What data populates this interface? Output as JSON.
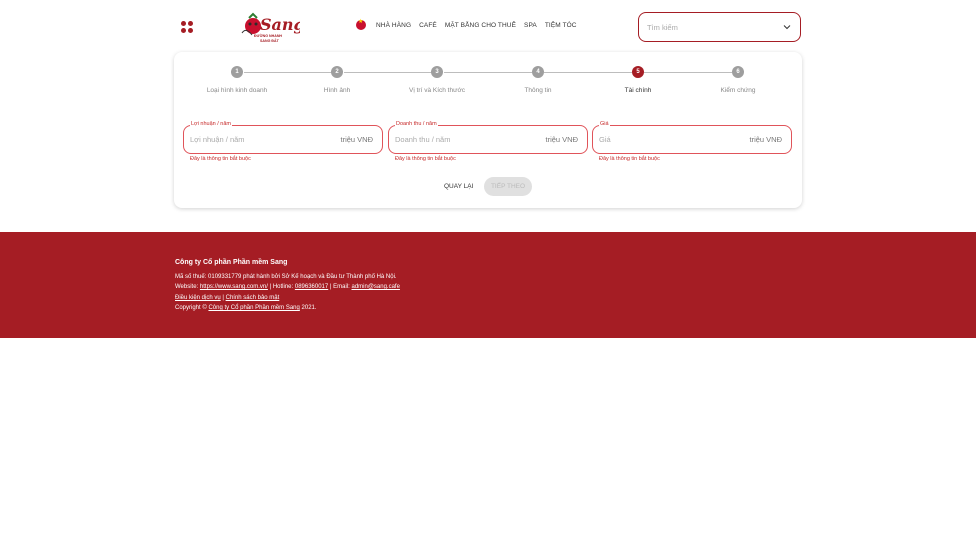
{
  "header": {
    "logo_text": "Sang",
    "logo_tagline": "ĐƯỜNG NHANH",
    "logo_sub": "SANG ĐẤT",
    "nav": [
      "NHÀ HÀNG",
      "CAFÉ",
      "MẶT BẰNG CHO THUÊ",
      "SPA",
      "TIỆM TÓC"
    ],
    "search_placeholder": "Tìm kiếm"
  },
  "stepper": {
    "steps": [
      {
        "number": "1",
        "label": "Loại hình kinh doanh",
        "active": false
      },
      {
        "number": "2",
        "label": "Hình ảnh",
        "active": false
      },
      {
        "number": "3",
        "label": "Vị trí và Kích thước",
        "active": false
      },
      {
        "number": "4",
        "label": "Thông tin",
        "active": false
      },
      {
        "number": "5",
        "label": "Tài chính",
        "active": true
      },
      {
        "number": "6",
        "label": "Kiểm chứng",
        "active": false
      }
    ]
  },
  "form": {
    "fields": [
      {
        "legend": "Lợi nhuận / năm",
        "placeholder": "Lợi nhuận / năm",
        "unit": "triệu VNĐ",
        "error": "Đây là thông tin bắt buộc"
      },
      {
        "legend": "Doanh thu / năm",
        "placeholder": "Doanh thu / năm",
        "unit": "triệu VNĐ",
        "error": "Đây là thông tin bắt buộc"
      },
      {
        "legend": "Giá",
        "placeholder": "Giá",
        "unit": "triệu VNĐ",
        "error": "Đây là thông tin bắt buộc"
      }
    ],
    "back_label": "QUAY LẠI",
    "next_label": "TIẾP THEO"
  },
  "footer": {
    "company": "Công ty Cổ phần Phần mềm Sang",
    "tax_line": "Mã số thuế: 0109331779 phát hành bởi Sở Kế hoạch và Đầu tư Thành phố Hà Nội.",
    "website_label": "Website:",
    "website_link": "https://www.sang.com.vn/",
    "hotline_label": "| Hotline:",
    "hotline": "0896360017",
    "email_label": "| Email:",
    "email": "admin@sang.cafe",
    "terms": "Điều kiện dịch vụ",
    "separator": "|",
    "privacy": "Chính sách bảo mật",
    "copyright_prefix": "Copyright ©",
    "copyright_link": "Công ty Cổ phần Phần mềm Sang",
    "copyright_year": "2021."
  },
  "colors": {
    "brand": "#a51d24",
    "error": "#c62828",
    "step_inactive": "#9e9e9e"
  }
}
